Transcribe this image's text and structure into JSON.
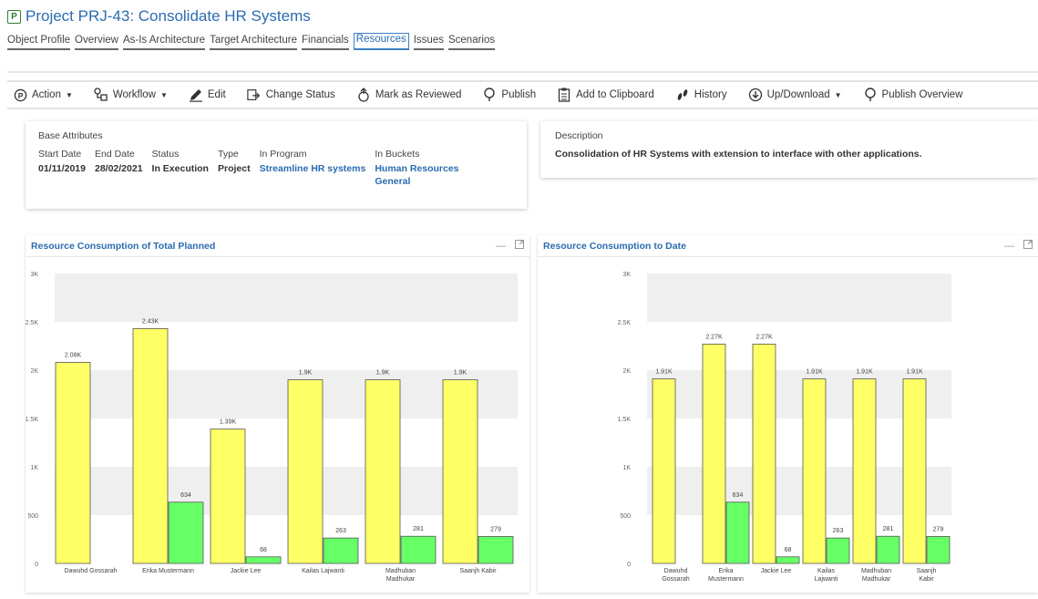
{
  "header": {
    "icon_letter": "P",
    "title": "Project PRJ-43: Consolidate HR Systems"
  },
  "tabs": [
    {
      "label": "Object Profile",
      "active": false
    },
    {
      "label": "Overview",
      "active": false
    },
    {
      "label": "As-Is Architecture",
      "active": false
    },
    {
      "label": "Target Architecture",
      "active": false
    },
    {
      "label": "Financials",
      "active": false
    },
    {
      "label": "Resources",
      "active": true
    },
    {
      "label": "Issues",
      "active": false
    },
    {
      "label": "Scenarios",
      "active": false
    }
  ],
  "toolbar": {
    "action": "Action",
    "workflow": "Workflow",
    "edit": "Edit",
    "change_status": "Change Status",
    "mark_reviewed": "Mark as Reviewed",
    "publish": "Publish",
    "add_clipboard": "Add to Clipboard",
    "history": "History",
    "up_download": "Up/Download",
    "publish_overview": "Publish Overview"
  },
  "base_attributes": {
    "heading": "Base Attributes",
    "start_date_label": "Start Date",
    "start_date": "01/11/2019",
    "end_date_label": "End Date",
    "end_date": "28/02/2021",
    "status_label": "Status",
    "status": "In Execution",
    "type_label": "Type",
    "type": "Project",
    "program_label": "In Program",
    "program": "Streamline HR systems",
    "buckets_label": "In Buckets",
    "bucket_1": "Human Resources",
    "bucket_2": "General"
  },
  "description": {
    "heading": "Description",
    "text": "Consolidation of HR Systems with extension to interface with other applications."
  },
  "colors": {
    "accent": "#2b6cb0",
    "planned_bar": "#ffff66",
    "actual_bar": "#66ff66",
    "band": "#efefef"
  },
  "chart_data": [
    {
      "type": "bar",
      "title": "Resource Consumption of Total Planned",
      "categories": [
        "Dawuhd Gossarah",
        "Erika Mustermann",
        "Jackie Lee",
        "Kailas Lajwanti",
        "Madhuban Madhukar",
        "Saanjh Kabir"
      ],
      "category_lines": [
        [
          "Dawuhd Gossarah"
        ],
        [
          "Erika Mustermann"
        ],
        [
          "Jackie Lee"
        ],
        [
          "Kailas Lajwanti"
        ],
        [
          "Madhuban",
          "Madhukar"
        ],
        [
          "Saanjh Kabir"
        ]
      ],
      "series": [
        {
          "values": [
            2080,
            2430,
            1390,
            1900,
            1900,
            1900
          ],
          "labels": [
            "2.08K",
            "2.43K",
            "1.39K",
            "1.9K",
            "1.9K",
            "1.9K"
          ],
          "color": "#ffff66"
        },
        {
          "values": [
            null,
            634,
            68,
            263,
            281,
            279
          ],
          "labels": [
            "",
            "634",
            "68",
            "263",
            "281",
            "279"
          ],
          "color": "#66ff66"
        }
      ],
      "yticks": [
        0,
        500,
        1000,
        1500,
        2000,
        2500,
        3000
      ],
      "ytick_labels": [
        "0",
        "500",
        "1K",
        "1.5K",
        "2K",
        "2.5K",
        "3K"
      ],
      "ylim": [
        0,
        3000
      ],
      "grid": "alternating bands"
    },
    {
      "type": "bar",
      "title": "Resource Consumption to Date",
      "categories": [
        "Dawuhd Gossarah",
        "Erika Mustermann",
        "Jackie Lee",
        "Kailas Lajwanti",
        "Madhuban Madhukar",
        "Saanjh Kabir"
      ],
      "category_lines": [
        [
          "Dawuhd",
          "Gossarah"
        ],
        [
          "Erika",
          "Mustermann"
        ],
        [
          "Jackie Lee"
        ],
        [
          "Kailas",
          "Lajwanti"
        ],
        [
          "Madhuban",
          "Madhukar"
        ],
        [
          "Saanjh",
          "Kabir"
        ]
      ],
      "series": [
        {
          "values": [
            1910,
            2270,
            2270,
            1910,
            1910,
            1910
          ],
          "labels": [
            "1.91K",
            "2.27K",
            "2.27K",
            "1.91K",
            "1.91K",
            "1.91K"
          ],
          "color": "#ffff66"
        },
        {
          "values": [
            null,
            634,
            68,
            263,
            281,
            279
          ],
          "labels": [
            "",
            "634",
            "68",
            "263",
            "281",
            "279"
          ],
          "color": "#66ff66"
        }
      ],
      "yticks": [
        0,
        500,
        1000,
        1500,
        2000,
        2500,
        3000
      ],
      "ytick_labels": [
        "0",
        "500",
        "1K",
        "1.5K",
        "2K",
        "2.5K",
        "3K"
      ],
      "ylim": [
        0,
        3000
      ],
      "grid": "alternating bands"
    }
  ]
}
